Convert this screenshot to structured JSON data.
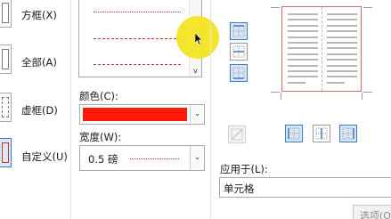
{
  "settings": {
    "items": [
      {
        "label": "方框(X)"
      },
      {
        "label": "全部(A)"
      },
      {
        "label": "虚框(D)"
      },
      {
        "label": "自定义(U)"
      }
    ]
  },
  "border_style": {
    "line_styles": [
      "dotted",
      "dashed",
      "dash-dot"
    ],
    "scroll_down_glyph": "v"
  },
  "color": {
    "label": "颜色(C):",
    "value_hex": "#ff1a0a"
  },
  "width": {
    "label": "宽度(W):",
    "value": "0.5 磅"
  },
  "preview": {
    "line_color": "#d76a6a"
  },
  "apply_to": {
    "label": "应用于(L):",
    "value": "单元格"
  },
  "options_button": {
    "label": "选项(O)..."
  },
  "colors": {
    "accent": "#3a78c9",
    "highlight": "#f4e31a"
  }
}
